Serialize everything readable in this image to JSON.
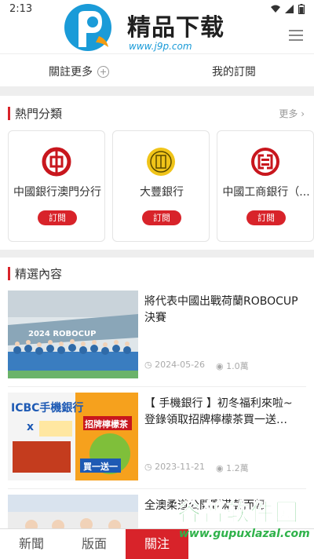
{
  "status_bar": {
    "time": "2:13"
  },
  "watermark_top": {
    "title": "精品下载",
    "url": "www.j9p.com"
  },
  "follow_tabs": {
    "follow_more": "關註更多",
    "my_subscriptions": "我的訂閱"
  },
  "hot_section": {
    "title": "熱門分類",
    "more": "更多",
    "cards": [
      {
        "name": "中國銀行澳門分行",
        "button": "訂閱",
        "icon": "boc-logo-icon"
      },
      {
        "name": "大豐銀行",
        "button": "訂閱",
        "icon": "taifung-logo-icon"
      },
      {
        "name": "中國工商銀行（...",
        "button": "訂閱",
        "icon": "icbc-logo-icon"
      }
    ]
  },
  "featured": {
    "title": "精選內容",
    "articles": [
      {
        "title": "將代表中國出戰荷蘭ROBOCUP決賽",
        "date": "2024-05-26",
        "views": "1.0萬",
        "thumb_text": "2024 ROBOCUP"
      },
      {
        "title": "【 手機銀行 】初冬福利來啦~ 登錄領取招牌檸檬茶買一送…",
        "date": "2023-11-21",
        "views": "1.2萬",
        "thumb_text_1": "ICBC手機銀行",
        "thumb_text_2": "招牌檸檬茶",
        "thumb_text_3": "買一送一"
      },
      {
        "title": "全澳柔道公開賽滿載而歸"
      }
    ]
  },
  "bottom_nav": {
    "news": "新聞",
    "layout": "版面",
    "follow": "關注"
  },
  "watermark_bottom": {
    "title": "谷普软件园",
    "url": "www.gupuxlazal.com"
  },
  "colors": {
    "accent": "#d8232a",
    "watermark_green": "#2fb24a"
  }
}
